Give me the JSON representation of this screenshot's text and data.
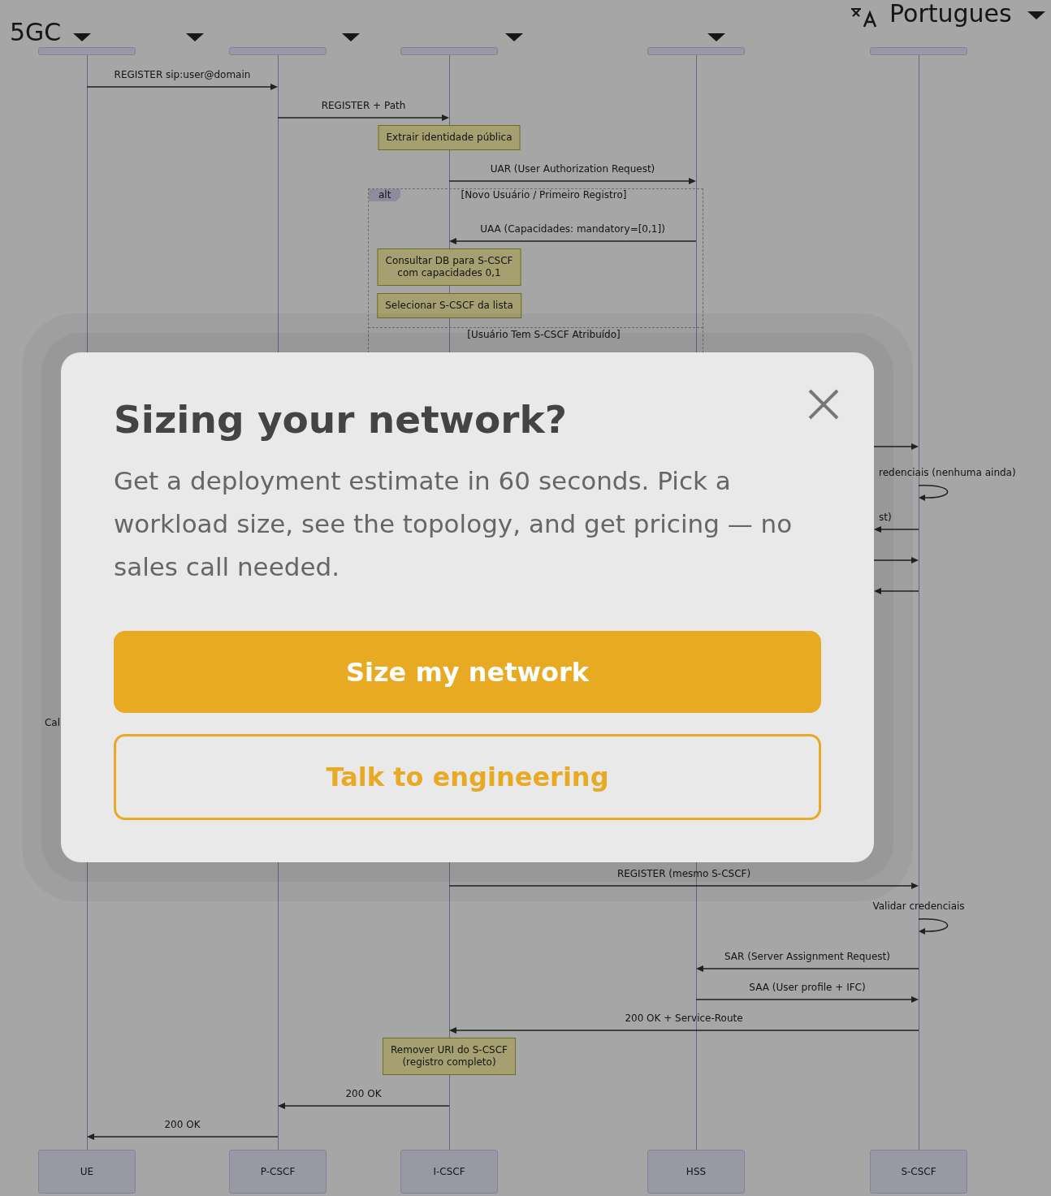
{
  "header": {
    "title": "5GC",
    "language": "Portugues"
  },
  "diagram": {
    "participants": [
      {
        "name": "UE"
      },
      {
        "name": "P-CSCF"
      },
      {
        "name": "I-CSCF"
      },
      {
        "name": "HSS"
      },
      {
        "name": "S-CSCF"
      }
    ],
    "steps_top": [
      {
        "kind": "message",
        "label": "REGISTER sip:user@domain"
      },
      {
        "kind": "message",
        "label": "REGISTER + Path"
      },
      {
        "kind": "note",
        "text": "Extrair identidade pública"
      },
      {
        "kind": "message",
        "label": "UAR (User Authorization Request)"
      },
      {
        "kind": "alt_start",
        "label": "alt",
        "condition": "[Novo Usuário / Primeiro Registro]"
      },
      {
        "kind": "message",
        "label": "UAA (Capacidades: mandatory=[0,1])"
      },
      {
        "kind": "note",
        "text": "Consultar DB para S-CSCF\ncom capacidades 0,1"
      },
      {
        "kind": "note",
        "text": "Selecionar S-CSCF da lista"
      },
      {
        "kind": "alt_else",
        "condition": "[Usuário Tem S-CSCF Atribuído]"
      }
    ],
    "steps_partly_covered": [
      {
        "kind": "message"
      },
      {
        "kind": "self",
        "label": "redenciais (nenhuma ainda)"
      },
      {
        "kind": "message",
        "label": "st)"
      },
      {
        "kind": "message"
      },
      {
        "kind": "message"
      },
      {
        "kind": "self",
        "label": "Cal"
      }
    ],
    "steps_bottom": [
      {
        "kind": "message",
        "label": "REGISTER (mesmo S-CSCF)"
      },
      {
        "kind": "self",
        "label": "Validar credenciais"
      },
      {
        "kind": "message",
        "label": "SAR (Server Assignment Request)"
      },
      {
        "kind": "message",
        "label": "SAA (User profile + IFC)"
      },
      {
        "kind": "message",
        "label": "200 OK + Service-Route"
      },
      {
        "kind": "note",
        "text": "Remover URI do S-CSCF\n(registro completo)"
      },
      {
        "kind": "message",
        "label": "200 OK"
      },
      {
        "kind": "message",
        "label": "200 OK"
      }
    ]
  },
  "modal": {
    "title": "Sizing your network?",
    "text": "Get a deployment estimate in 60 seconds. Pick a workload size, see the topology, and get pricing — no sales call needed.",
    "buttons": [
      {
        "label": "Size my network",
        "kind": "primary"
      },
      {
        "label": "Talk to engineering",
        "kind": "secondary"
      }
    ]
  }
}
